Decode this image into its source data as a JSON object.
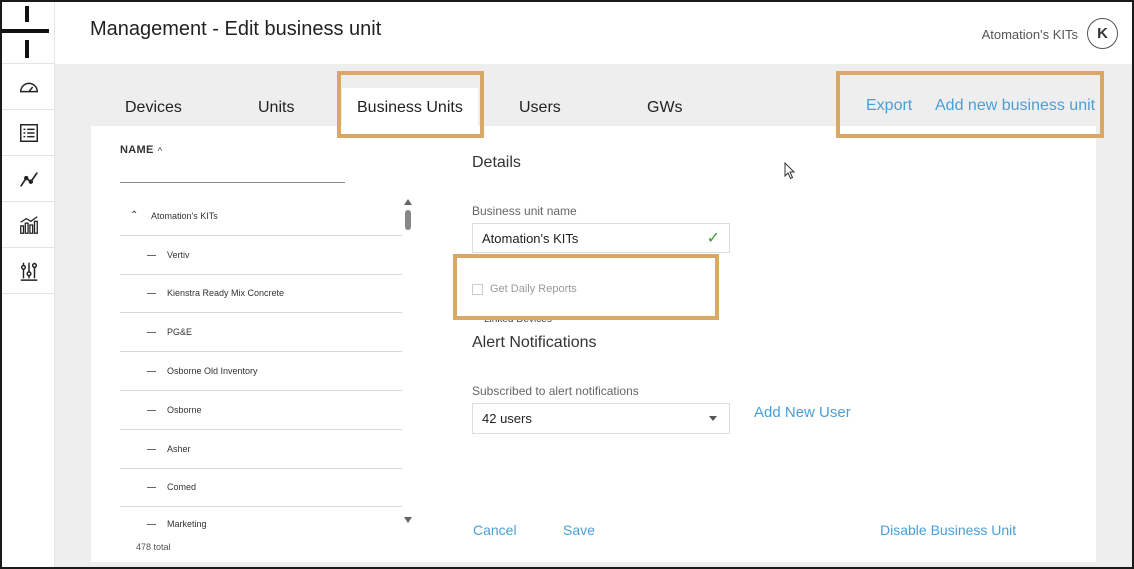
{
  "header": {
    "title": "Management - Edit business unit",
    "user_name": "Atomation's KITs",
    "avatar_letter": "K"
  },
  "sidebar": {
    "items": [
      {
        "icon": "speedometer-icon"
      },
      {
        "icon": "list-icon"
      },
      {
        "icon": "line-chart-icon"
      },
      {
        "icon": "bar-chart-icon"
      },
      {
        "icon": "settings-sliders-icon"
      }
    ]
  },
  "tabs": [
    {
      "label": "Devices",
      "active": false
    },
    {
      "label": "Units",
      "active": false
    },
    {
      "label": "Business Units",
      "active": true
    },
    {
      "label": "Users",
      "active": false
    },
    {
      "label": "GWs",
      "active": false
    }
  ],
  "actions": {
    "export": "Export",
    "add_business_unit": "Add new business unit"
  },
  "list": {
    "column_header": "NAME",
    "sort_indicator": "^",
    "items": [
      "Atomation's KITs",
      "Vertiv",
      "Kienstra Ready Mix Concrete",
      "PG&E",
      "Osborne Old Inventory",
      "Osborne",
      "Asher",
      "Comed",
      "Marketing"
    ],
    "total": "478 total"
  },
  "details": {
    "title": "Details",
    "name_label": "Business unit name",
    "name_value": "Atomation's KITs",
    "daily_reports_label": "Get Daily Reports",
    "daily_reports_checked": false,
    "linked_devices_label": "Linked Devices",
    "alert_title": "Alert Notifications",
    "subscribed_label": "Subscribed to alert notifications",
    "subscribed_value": "42 users",
    "add_user": "Add New User"
  },
  "footer": {
    "cancel": "Cancel",
    "save": "Save",
    "disable": "Disable Business Unit"
  },
  "colors": {
    "accent": "#4a9fd6",
    "highlight": "#d9a866",
    "success": "#3a9f3a"
  }
}
